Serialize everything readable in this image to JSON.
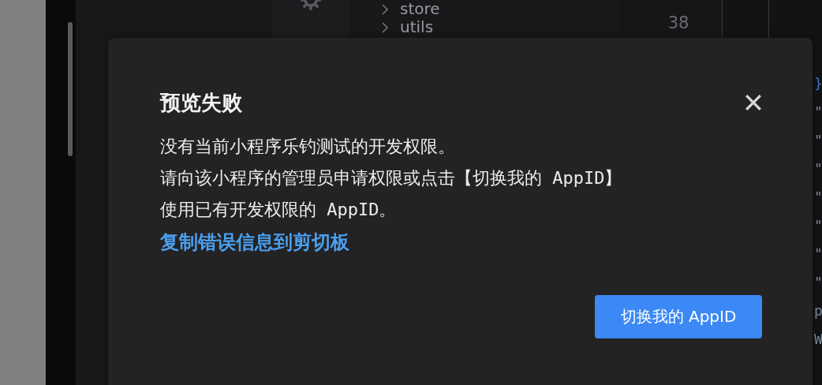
{
  "editor": {
    "tree_items": [
      {
        "label": "store",
        "expanded": false
      },
      {
        "label": "utils",
        "expanded": false
      }
    ],
    "line_numbers": [
      "38"
    ],
    "code_fragments": [
      "}",
      "\"",
      "\"",
      "\"",
      "\"",
      "\"",
      "\"",
      "\"",
      "p",
      "W"
    ]
  },
  "dialog": {
    "title": "预览失败",
    "message_lines": [
      "没有当前小程序乐钓测试的开发权限。",
      "请向该小程序的管理员申请权限或点击【切换我的 AppID】",
      "使用已有开发权限的 AppID。"
    ],
    "link": "复制错误信息到剪切板",
    "button": "切换我的 AppID"
  }
}
